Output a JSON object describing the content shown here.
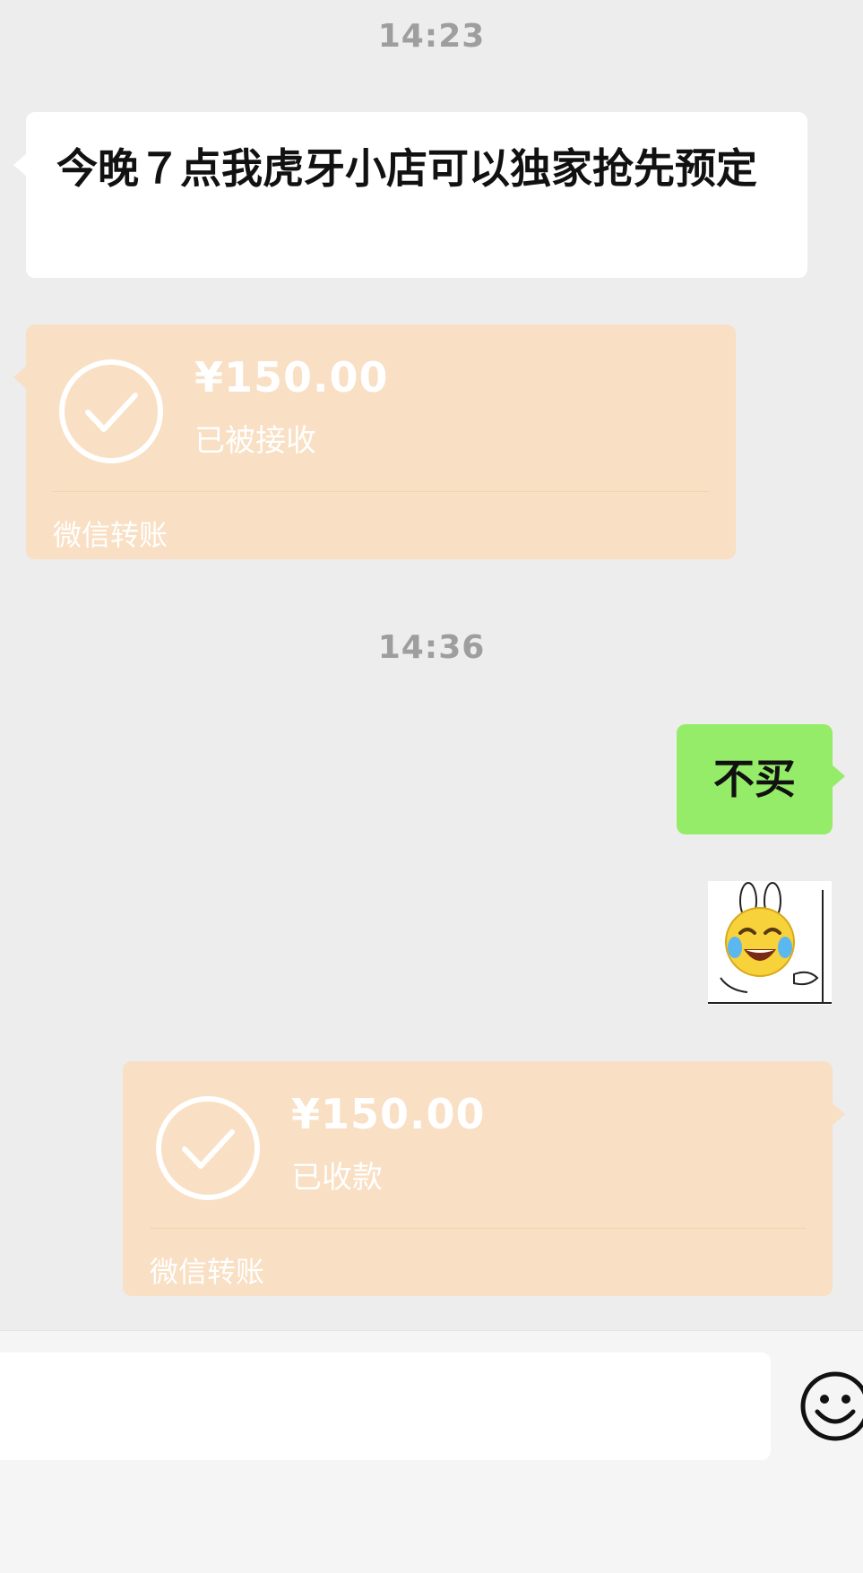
{
  "chat": {
    "messages": [
      {
        "type": "time",
        "text": "14:23"
      },
      {
        "type": "text",
        "side": "left",
        "text": "今晚７点我虎牙小店可以独家抢先预定"
      },
      {
        "type": "transfer",
        "side": "left",
        "amount": "¥150.00",
        "status": "已被接收",
        "footer": "微信转账"
      },
      {
        "type": "time",
        "text": "14:36"
      },
      {
        "type": "text",
        "side": "right",
        "text": "不买"
      },
      {
        "type": "sticker",
        "side": "right",
        "icon": "crying-laughing-bunny-sticker"
      },
      {
        "type": "transfer",
        "side": "right",
        "amount": "¥150.00",
        "status": "已收款",
        "footer": "微信转账"
      }
    ]
  },
  "input_bar": {
    "value": "",
    "emoji_icon": "smiley-face-icon"
  },
  "colors": {
    "background": "#ededed",
    "self_bubble": "#95ec69",
    "other_bubble": "#ffffff",
    "transfer_card": "#f9dfc3",
    "timestamp": "#9e9e9e"
  }
}
